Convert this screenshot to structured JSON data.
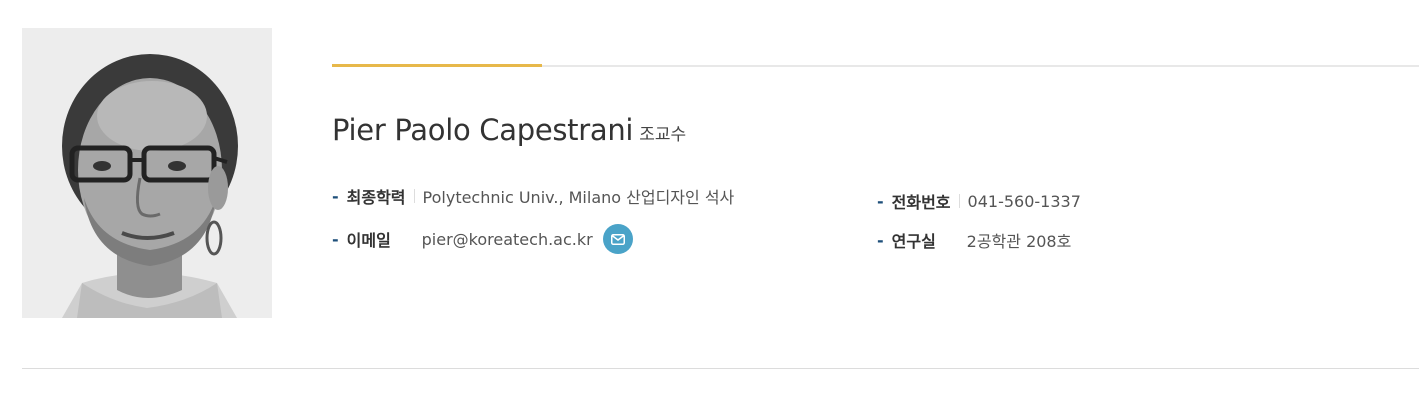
{
  "profile": {
    "name": "Pier Paolo Capestrani",
    "title": "조교수"
  },
  "info": {
    "education": {
      "label": "최종학력",
      "value": "Polytechnic Univ., Milano 산업디자인 석사"
    },
    "phone": {
      "label": "전화번호",
      "value": "041-560-1337"
    },
    "email": {
      "label": "이메일",
      "value": "pier@koreatech.ac.kr"
    },
    "office": {
      "label": "연구실",
      "value": "2공학관 208호"
    }
  },
  "icons": {
    "email_button": "mail-icon"
  },
  "colors": {
    "accent_line": "#e7b84a",
    "bullet": "#1e4f7a",
    "mail_button": "#4aa3c8"
  }
}
